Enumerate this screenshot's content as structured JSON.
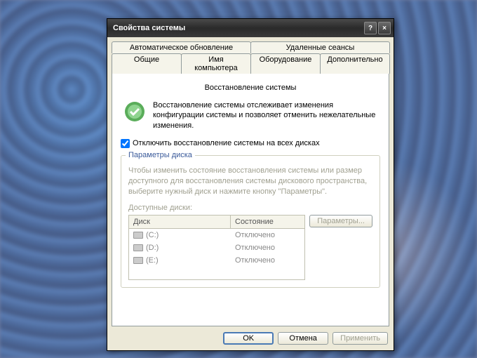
{
  "window": {
    "title": "Свойства системы",
    "help": "?",
    "close": "×"
  },
  "tabs": {
    "row1": [
      {
        "label": "Автоматическое обновление"
      },
      {
        "label": "Удаленные сеансы"
      }
    ],
    "row2": [
      {
        "label": "Общие"
      },
      {
        "label": "Имя компьютера"
      },
      {
        "label": "Оборудование"
      },
      {
        "label": "Дополнительно"
      }
    ],
    "active_title": "Восстановление системы"
  },
  "intro": "Восстановление системы отслеживает изменения конфигурации системы и позволяет отменить нежелательные изменения.",
  "checkbox": {
    "label": "Отключить восстановление системы на всех дисках",
    "checked": true
  },
  "groupbox": {
    "title": "Параметры диска",
    "disabled_text": "Чтобы изменить состояние восстановления системы или размер доступного для восстановления системы дискового пространства, выберите нужный диск и нажмите кнопку \"Параметры\".",
    "available_label": "Доступные диски:",
    "columns": {
      "disk": "Диск",
      "state": "Состояние"
    },
    "drives": [
      {
        "name": "(C:)",
        "state": "Отключено"
      },
      {
        "name": "(D:)",
        "state": "Отключено"
      },
      {
        "name": "(E:)",
        "state": "Отключено"
      }
    ],
    "params_btn": "Параметры..."
  },
  "buttons": {
    "ok": "OK",
    "cancel": "Отмена",
    "apply": "Применить"
  }
}
